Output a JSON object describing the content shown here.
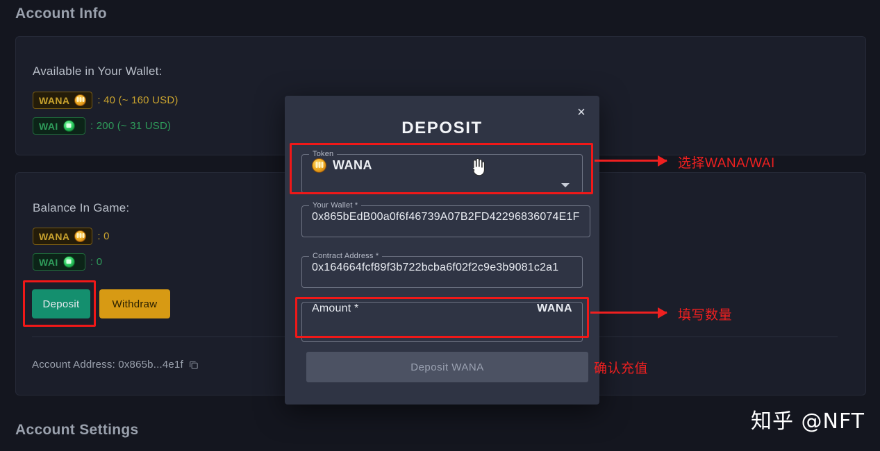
{
  "page": {
    "headings": {
      "account_info": "Account Info",
      "account_settings": "Account Settings"
    },
    "watermark": "知乎 @NFT"
  },
  "wallet_panel": {
    "label": "Available in Your Wallet:",
    "tokens": [
      {
        "symbol": "WANA",
        "icon": "gold-coin-icon",
        "value": ": 40 (~ 160 USD)"
      },
      {
        "symbol": "WAI",
        "icon": "green-coin-icon",
        "value": ": 200 (~ 31 USD)"
      }
    ]
  },
  "balance_panel": {
    "label": "Balance In Game:",
    "tokens": [
      {
        "symbol": "WANA",
        "icon": "gold-coin-icon",
        "value": ": 0"
      },
      {
        "symbol": "WAI",
        "icon": "green-coin-icon",
        "value": ": 0"
      }
    ],
    "buttons": {
      "deposit": "Deposit",
      "withdraw": "Withdraw"
    },
    "account_address_label": "Account Address: 0x865b...4e1f"
  },
  "modal": {
    "title": "DEPOSIT",
    "close_label": "×",
    "token_field": {
      "legend": "Token",
      "selected": "WANA",
      "icon": "gold-coin-icon",
      "caret": "chevron-down-icon"
    },
    "wallet_field": {
      "legend": "Your Wallet *",
      "value": "0x865bEdB00a0f6f46739A07B2FD42296836074E1F"
    },
    "contract_field": {
      "legend": "Contract Address *",
      "value": "0x164664fcf89f3b722bcba6f02f2c9e3b9081c2a1"
    },
    "amount_field": {
      "placeholder": "Amount *",
      "unit": "WANA"
    },
    "submit_label": "Deposit WANA"
  },
  "annotations": {
    "select_token": "选择WANA/WAI",
    "enter_amount": "填写数量",
    "confirm_deposit": "确认充值",
    "color": "#ef2020"
  },
  "colors": {
    "background": "#14161f",
    "panel": "#1b1e2a",
    "modal": "#2f3444",
    "deposit_green": "#148f6e",
    "withdraw_gold": "#d79a14",
    "wana_gold": "#c8a22e",
    "wai_green": "#2f9d5b"
  }
}
